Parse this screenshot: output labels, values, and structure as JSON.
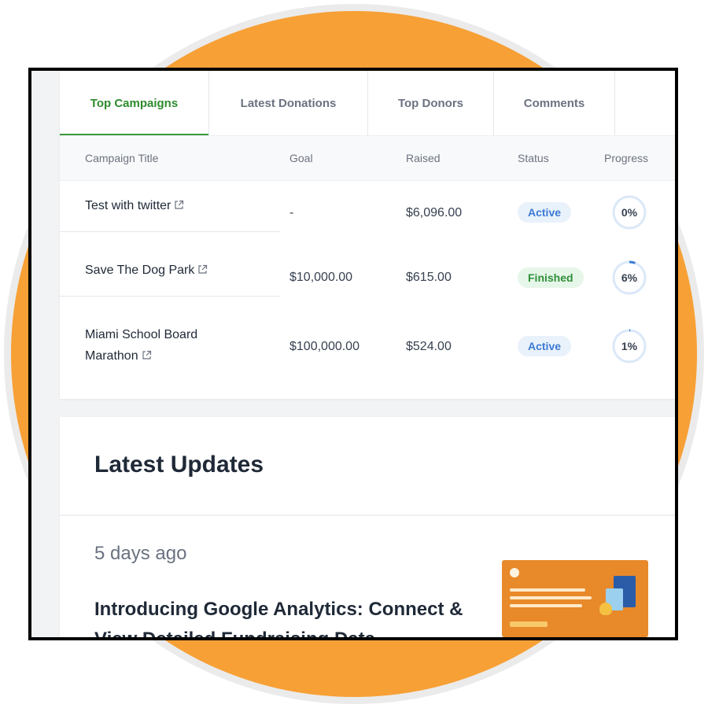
{
  "tabs": [
    {
      "label": "Top Campaigns",
      "active": true
    },
    {
      "label": "Latest Donations",
      "active": false
    },
    {
      "label": "Top Donors",
      "active": false
    },
    {
      "label": "Comments",
      "active": false
    }
  ],
  "table": {
    "headers": {
      "title": "Campaign Title",
      "goal": "Goal",
      "raised": "Raised",
      "status": "Status",
      "progress": "Progress"
    },
    "rows": [
      {
        "title": "Test with twitter",
        "goal": "-",
        "raised": "$6,096.00",
        "status": "Active",
        "progress_label": "0%",
        "progress": 0
      },
      {
        "title": "Save The Dog Park",
        "goal": "$10,000.00",
        "raised": "$615.00",
        "status": "Finished",
        "progress_label": "6%",
        "progress": 6
      },
      {
        "title_line1": "Miami School Board",
        "title_line2": "Marathon",
        "goal": "$100,000.00",
        "raised": "$524.00",
        "status": "Active",
        "progress_label": "1%",
        "progress": 1
      }
    ]
  },
  "updates": {
    "title": "Latest Updates",
    "items": [
      {
        "time": "5 days ago",
        "headline": "Introducing Google Analytics: Connect & View Detailed Fundraising Data"
      }
    ]
  },
  "icons": {
    "external_link": "external-link-icon"
  },
  "colors": {
    "accent_green": "#2e8b2e",
    "active_badge_bg": "#e9f1fb",
    "active_badge_text": "#3b7bd4",
    "finished_badge_bg": "#e6f6e8",
    "finished_badge_text": "#2f8f3a",
    "progress_track": "#dbe8f8",
    "progress_fill": "#3b7bd4",
    "background_orange": "#f7a036"
  }
}
